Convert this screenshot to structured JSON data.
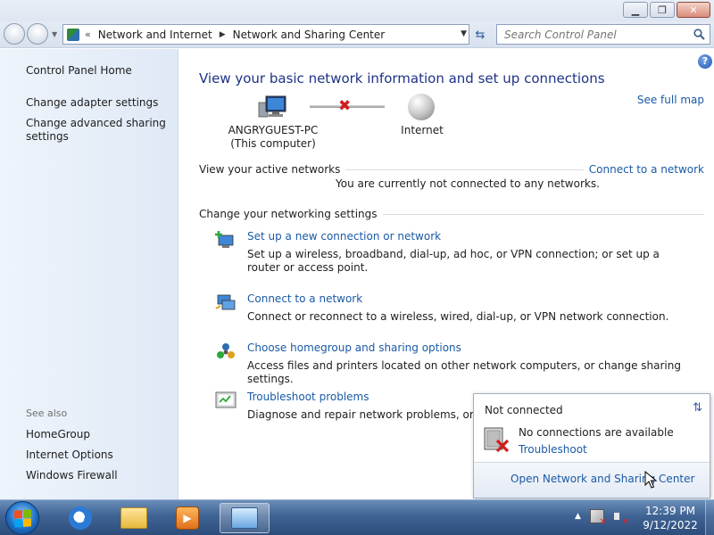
{
  "breadcrumb": {
    "items": [
      "Network and Internet",
      "Network and Sharing Center"
    ]
  },
  "search": {
    "placeholder": "Search Control Panel"
  },
  "sidebar": {
    "home": "Control Panel Home",
    "links": [
      "Change adapter settings",
      "Change advanced sharing settings"
    ],
    "see_also_label": "See also",
    "see_also": [
      "HomeGroup",
      "Internet Options",
      "Windows Firewall"
    ]
  },
  "main": {
    "title": "View your basic network information and set up connections",
    "see_full_map": "See full map",
    "computer_name": "ANGRYGUEST-PC",
    "computer_sub": "(This computer)",
    "internet_label": "Internet",
    "active_networks_label": "View your active networks",
    "connect_link": "Connect to a network",
    "not_connected_msg": "You are currently not connected to any networks.",
    "change_settings_label": "Change your networking settings",
    "tasks": [
      {
        "link": "Set up a new connection or network",
        "desc": "Set up a wireless, broadband, dial-up, ad hoc, or VPN connection; or set up a router or access point."
      },
      {
        "link": "Connect to a network",
        "desc": "Connect or reconnect to a wireless, wired, dial-up, or VPN network connection."
      },
      {
        "link": "Choose homegroup and sharing options",
        "desc": "Access files and printers located on other network computers, or change sharing settings."
      },
      {
        "link": "Troubleshoot problems",
        "desc": "Diagnose and repair network problems, or get tr"
      }
    ]
  },
  "popup": {
    "title": "Not connected",
    "status": "No connections are available",
    "troubleshoot": "Troubleshoot",
    "open_center": "Open Network and Sharing Center"
  },
  "taskbar": {
    "time": "12:39 PM",
    "date": "9/12/2022"
  },
  "colors": {
    "link": "#1a5aa6",
    "title": "#1e3287",
    "error_x": "#d11e1e"
  }
}
